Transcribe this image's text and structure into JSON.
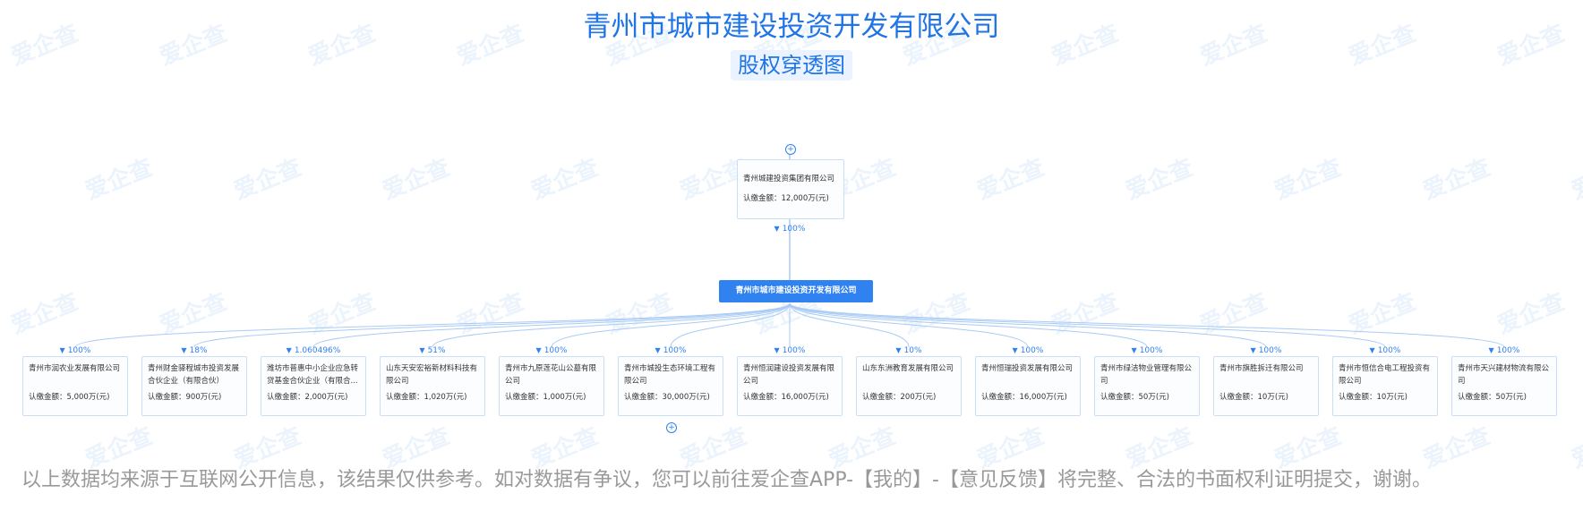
{
  "header": {
    "title": "青州市城市建设投资开发有限公司",
    "subtitle": "股权穿透图"
  },
  "watermark": {
    "text": "爱企查"
  },
  "shareholder": {
    "name": "青州城建投资集团有限公司",
    "amount": "认缴金额：12,000万(元)",
    "percent": "100%"
  },
  "center": {
    "name": "青州市城市建设投资开发有限公司"
  },
  "investments": [
    {
      "percent": "100%",
      "name": "青州市润农业发展有限公司",
      "amount": "认缴金额：5,000万(元)"
    },
    {
      "percent": "18%",
      "name": "青州财金驿程城市投资发展合伙企业（有限合伙）",
      "amount": "认缴金额：900万(元)"
    },
    {
      "percent": "1.060496%",
      "name": "潍坊市普惠中小企业应急转贷基金合伙企业（有限合...",
      "amount": "认缴金额：2,000万(元)"
    },
    {
      "percent": "51%",
      "name": "山东天安宏裕新材料科技有限公司",
      "amount": "认缴金额：1,020万(元)"
    },
    {
      "percent": "100%",
      "name": "青州市九原莲花山公墓有限公司",
      "amount": "认缴金额：1,000万(元)"
    },
    {
      "percent": "100%",
      "name": "青州市城投生态环境工程有限公司",
      "amount": "认缴金额：30,000万(元)"
    },
    {
      "percent": "100%",
      "name": "青州恒润建设投资发展有限公司",
      "amount": "认缴金额：16,000万(元)"
    },
    {
      "percent": "10%",
      "name": "山东东洲教育发展有限公司",
      "amount": "认缴金额：200万(元)"
    },
    {
      "percent": "100%",
      "name": "青州恒瑞投资发展有限公司",
      "amount": "认缴金额：16,000万(元)"
    },
    {
      "percent": "100%",
      "name": "青州市绿洁物业管理有限公司",
      "amount": "认缴金额：50万(元)"
    },
    {
      "percent": "100%",
      "name": "青州市旗胜拆迁有限公司",
      "amount": "认缴金额：10万(元)"
    },
    {
      "percent": "100%",
      "name": "青州市恒信合电工程投资有限公司",
      "amount": "认缴金额：10万(元)"
    },
    {
      "percent": "100%",
      "name": "青州市天兴建材物流有限公司",
      "amount": "认缴金额：50万(元)"
    }
  ],
  "expand_icons": {
    "top": "+",
    "bottom": "+"
  },
  "footer": {
    "disclaimer": "以上数据均来源于互联网公开信息，该结果仅供参考。如对数据有争议，您可以前往爱企查APP-【我的】-【意见反馈】将完整、合法的书面权利证明提交，谢谢。"
  }
}
